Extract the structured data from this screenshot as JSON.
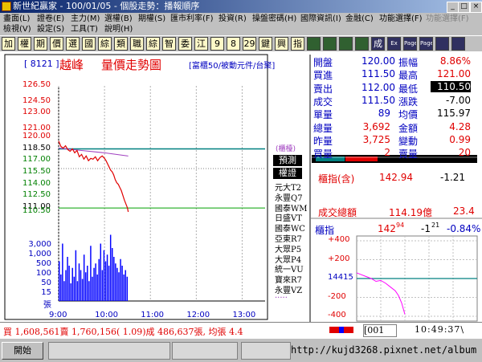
{
  "window": {
    "title": "新世紀贏家 - 100/01/05 - 個股走勢：播報順序"
  },
  "menu": {
    "row1": [
      "畫面(L)",
      "證卷(E)",
      "主力(M)",
      "選權(B)",
      "期權(S)",
      "匯市利率(F)",
      "投資(R)",
      "操盤密碼(H)",
      "國際資訊(I)",
      "金融(C)",
      "功能選擇(F)",
      "功能選擇(F)"
    ],
    "row2": [
      "檢視(V)",
      "設定(S)",
      "工具(T)",
      "說明(H)"
    ]
  },
  "toolbar": {
    "buttons": [
      "加",
      "權",
      "期",
      "價",
      "選",
      "國",
      "綜",
      "類",
      "職",
      "綜",
      "智",
      "委",
      "江",
      "9",
      "8",
      "29",
      "鍵",
      "興",
      "指",
      "",
      "",
      "",
      "",
      "成",
      "Ex",
      "Page",
      "Page",
      "",
      ""
    ]
  },
  "stock": {
    "code": "[ 8121 ]",
    "name": "越峰",
    "chart_title": "量價走勢圖",
    "category": "[富櫃50/被動元件/台聚]"
  },
  "chart_data": {
    "type": "line",
    "price_axis": [
      126.5,
      124.5,
      123.0,
      121.0,
      120.0,
      118.5,
      117.0,
      115.5,
      114.0,
      112.5,
      111.0,
      110.5
    ],
    "price_ticks": [
      "126.50",
      "124.50",
      "123.00",
      "121.00",
      "120.00",
      "118.50",
      "117.00",
      "115.50",
      "114.00",
      "112.50",
      "111.00",
      "110.50"
    ],
    "volume_ticks": [
      "3,000",
      "1,000",
      "500",
      "100",
      "50",
      "15",
      "張"
    ],
    "time_ticks": [
      "9:00",
      "10:00",
      "11:00",
      "12:00",
      "13:00"
    ],
    "reference_price": 118.5,
    "prev_close_line": 116.0,
    "price_line": [
      [
        0,
        119.5
      ],
      [
        3,
        118.8
      ],
      [
        6,
        118.6
      ],
      [
        9,
        118.9
      ],
      [
        12,
        118.4
      ],
      [
        15,
        118.2
      ],
      [
        18,
        118.5
      ],
      [
        21,
        118.0
      ],
      [
        24,
        118.3
      ],
      [
        27,
        117.5
      ],
      [
        30,
        117.8
      ],
      [
        33,
        117.2
      ],
      [
        36,
        117.6
      ],
      [
        39,
        117.0
      ],
      [
        42,
        117.3
      ],
      [
        45,
        117.2
      ],
      [
        48,
        117.5
      ],
      [
        51,
        117.0
      ],
      [
        54,
        117.4
      ],
      [
        57,
        117.6
      ],
      [
        60,
        117.3
      ],
      [
        62,
        117.0
      ],
      [
        64,
        116.6
      ],
      [
        66,
        116.2
      ],
      [
        68,
        115.8
      ],
      [
        70,
        115.6
      ],
      [
        72,
        115.2
      ],
      [
        74,
        114.6
      ],
      [
        76,
        114.2
      ],
      [
        78,
        114.0
      ],
      [
        80,
        113.6
      ],
      [
        82,
        113.2
      ],
      [
        84,
        112.6
      ],
      [
        86,
        112.0
      ],
      [
        88,
        111.5
      ],
      [
        90,
        111.0
      ],
      [
        91,
        110.5
      ]
    ],
    "avg_line": [
      [
        0,
        118.6
      ],
      [
        30,
        118.3
      ],
      [
        60,
        118.0
      ],
      [
        91,
        117.6
      ]
    ],
    "volume": [
      180,
      120,
      260,
      90,
      140,
      200,
      160,
      80,
      150,
      110,
      230,
      90,
      170,
      140,
      100,
      210,
      130,
      160,
      90,
      250,
      110,
      150,
      170,
      120,
      190,
      260,
      140,
      230,
      180,
      210,
      160,
      300,
      240,
      200,
      170,
      150,
      130,
      190,
      160,
      120,
      140,
      110
    ],
    "volume_max": 3000
  },
  "quote": {
    "labels": [
      "開盤",
      "買進",
      "賣出",
      "成交",
      "單量",
      "總量",
      "昨量",
      "買量"
    ],
    "values": [
      "120.00",
      "111.50",
      "112.00",
      "111.50",
      "89",
      "3,692",
      "3,725",
      "2"
    ],
    "labels2": [
      "振幅",
      "最高",
      "最低",
      "漲跌",
      "均價",
      "金額",
      "變動",
      "賣量"
    ],
    "values2": [
      "8.86%",
      "121.00",
      "110.50",
      "-7.00",
      "115.97",
      "4.28",
      "0.99",
      "20"
    ]
  },
  "broker_list": {
    "header1": "(櫃檯)",
    "header2": "預測",
    "header3": "權證",
    "items": [
      "元大T2",
      "永豐Q7",
      "國泰WM",
      "日盛VT",
      "國泰WC",
      "亞東R7",
      "大眾P5",
      "大眾P4",
      "統一VU",
      "寶來R7",
      "永豐VZ",
      "·····"
    ]
  },
  "index": {
    "otc_label": "櫃指(含)",
    "otc_value": "142.94",
    "otc_change": "-1.21",
    "turnover_label": "成交總額",
    "turnover_value": "114.19億",
    "turnover_change": "23.4",
    "mini_label": "櫃指",
    "mini_value": "142",
    "mini_value_sup": "94",
    "mini_change": "-1",
    "mini_change_sup": "21",
    "mini_pct": "-0.84%",
    "mini_ticks": [
      "+400",
      "+200",
      "14415",
      "-200",
      "-400"
    ]
  },
  "status": {
    "summary": "買 1,608,561賣 1,760,156( 1.09)成 486,637張, 均張 4.4",
    "input_value": "[001",
    "clock": "10:49:37\\"
  },
  "taskbar": {
    "start_label": "開始",
    "watermark": "http://kujd3268.pixnet.net/album"
  },
  "colors": {
    "price_line": "#e00000",
    "avg_line": "#a040c0",
    "ref_line": "#008080",
    "volume": "#0000ff",
    "up": "#e00000",
    "down": "#008000"
  }
}
